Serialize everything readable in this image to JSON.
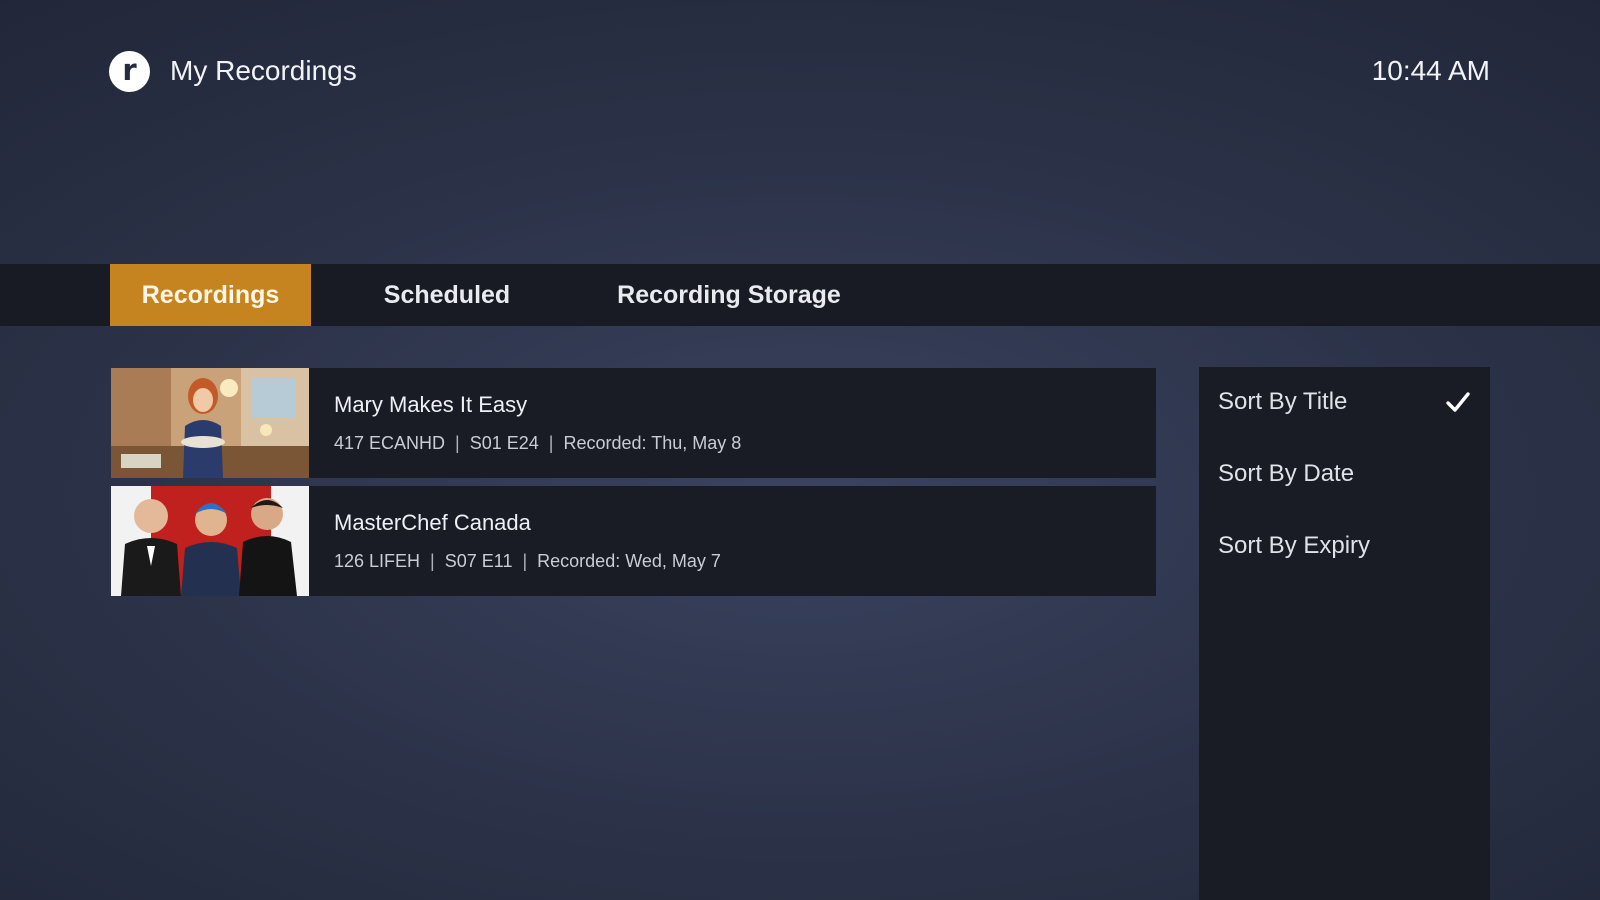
{
  "header": {
    "logo_letter": "r",
    "title": "My Recordings",
    "time": "10:44 AM"
  },
  "tabs": [
    {
      "label": "Recordings",
      "active": true
    },
    {
      "label": "Scheduled",
      "active": false
    },
    {
      "label": "Recording Storage",
      "active": false
    }
  ],
  "recordings": [
    {
      "title": "Mary Makes It Easy",
      "channel": "417 ECANHD",
      "episode": "S01 E24",
      "recorded": "Recorded: Thu, May 8",
      "thumbnail": "mary-makes-it-easy-thumbnail"
    },
    {
      "title": "MasterChef Canada",
      "channel": "126 LIFEH",
      "episode": "S07 E11",
      "recorded": "Recorded: Wed, May 7",
      "thumbnail": "masterchef-canada-thumbnail"
    }
  ],
  "meta_separator": "|",
  "sort_menu": {
    "options": [
      {
        "label": "Sort By Title",
        "selected": true
      },
      {
        "label": "Sort By Date",
        "selected": false
      },
      {
        "label": "Sort By Expiry",
        "selected": false
      }
    ],
    "check_icon": "checkmark-icon"
  },
  "colors": {
    "accent": "#c5841f",
    "panel": "#191c25",
    "tabbar": "#181b24",
    "background": "#2c3349"
  }
}
